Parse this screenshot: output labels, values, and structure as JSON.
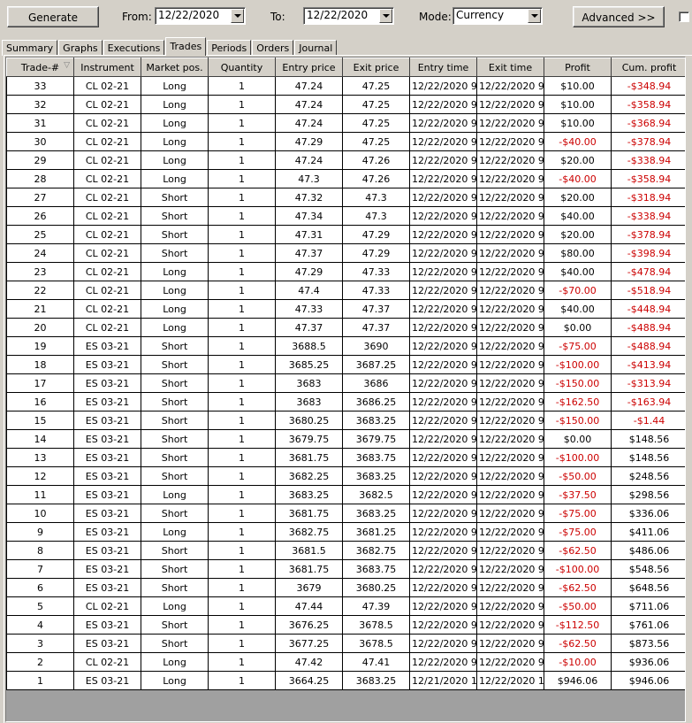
{
  "toolbar": {
    "generate_label": "Generate",
    "from_label": "From:",
    "from_value": "12/22/2020",
    "to_label": "To:",
    "to_value": "12/22/2020",
    "mode_label": "Mode:",
    "mode_value": "Currency",
    "advanced_label": "Advanced >>"
  },
  "tabs": [
    "Summary",
    "Graphs",
    "Executions",
    "Trades",
    "Periods",
    "Orders",
    "Journal"
  ],
  "active_tab": "Trades",
  "columns": [
    "Trade-#",
    "Instrument",
    "Market pos.",
    "Quantity",
    "Entry price",
    "Exit price",
    "Entry time",
    "Exit time",
    "Profit",
    "Cum. profit"
  ],
  "sort_indicator": "▽",
  "rows": [
    [
      "33",
      "CL 02-21",
      "Long",
      "1",
      "47.24",
      "47.25",
      "12/22/2020 9:",
      "12/22/2020 9:",
      "$10.00",
      "-$348.94"
    ],
    [
      "32",
      "CL 02-21",
      "Long",
      "1",
      "47.24",
      "47.25",
      "12/22/2020 9:",
      "12/22/2020 9:",
      "$10.00",
      "-$358.94"
    ],
    [
      "31",
      "CL 02-21",
      "Long",
      "1",
      "47.24",
      "47.25",
      "12/22/2020 9:",
      "12/22/2020 9:",
      "$10.00",
      "-$368.94"
    ],
    [
      "30",
      "CL 02-21",
      "Long",
      "1",
      "47.29",
      "47.25",
      "12/22/2020 9:",
      "12/22/2020 9:",
      "-$40.00",
      "-$378.94"
    ],
    [
      "29",
      "CL 02-21",
      "Long",
      "1",
      "47.24",
      "47.26",
      "12/22/2020 9:",
      "12/22/2020 9:",
      "$20.00",
      "-$338.94"
    ],
    [
      "28",
      "CL 02-21",
      "Long",
      "1",
      "47.3",
      "47.26",
      "12/22/2020 9:",
      "12/22/2020 9:",
      "-$40.00",
      "-$358.94"
    ],
    [
      "27",
      "CL 02-21",
      "Short",
      "1",
      "47.32",
      "47.3",
      "12/22/2020 9:",
      "12/22/2020 9:",
      "$20.00",
      "-$318.94"
    ],
    [
      "26",
      "CL 02-21",
      "Short",
      "1",
      "47.34",
      "47.3",
      "12/22/2020 9:",
      "12/22/2020 9:",
      "$40.00",
      "-$338.94"
    ],
    [
      "25",
      "CL 02-21",
      "Short",
      "1",
      "47.31",
      "47.29",
      "12/22/2020 9:",
      "12/22/2020 9:",
      "$20.00",
      "-$378.94"
    ],
    [
      "24",
      "CL 02-21",
      "Short",
      "1",
      "47.37",
      "47.29",
      "12/22/2020 9:",
      "12/22/2020 9:",
      "$80.00",
      "-$398.94"
    ],
    [
      "23",
      "CL 02-21",
      "Long",
      "1",
      "47.29",
      "47.33",
      "12/22/2020 9:",
      "12/22/2020 9:",
      "$40.00",
      "-$478.94"
    ],
    [
      "22",
      "CL 02-21",
      "Long",
      "1",
      "47.4",
      "47.33",
      "12/22/2020 9:",
      "12/22/2020 9:",
      "-$70.00",
      "-$518.94"
    ],
    [
      "21",
      "CL 02-21",
      "Long",
      "1",
      "47.33",
      "47.37",
      "12/22/2020 9:",
      "12/22/2020 9:",
      "$40.00",
      "-$448.94"
    ],
    [
      "20",
      "CL 02-21",
      "Long",
      "1",
      "47.37",
      "47.37",
      "12/22/2020 9:",
      "12/22/2020 9:",
      "$0.00",
      "-$488.94"
    ],
    [
      "19",
      "ES 03-21",
      "Short",
      "1",
      "3688.5",
      "3690",
      "12/22/2020 9:",
      "12/22/2020 9:",
      "-$75.00",
      "-$488.94"
    ],
    [
      "18",
      "ES 03-21",
      "Short",
      "1",
      "3685.25",
      "3687.25",
      "12/22/2020 9:",
      "12/22/2020 9:",
      "-$100.00",
      "-$413.94"
    ],
    [
      "17",
      "ES 03-21",
      "Short",
      "1",
      "3683",
      "3686",
      "12/22/2020 9:",
      "12/22/2020 9:",
      "-$150.00",
      "-$313.94"
    ],
    [
      "16",
      "ES 03-21",
      "Short",
      "1",
      "3683",
      "3686.25",
      "12/22/2020 9:",
      "12/22/2020 9:",
      "-$162.50",
      "-$163.94"
    ],
    [
      "15",
      "ES 03-21",
      "Short",
      "1",
      "3680.25",
      "3683.25",
      "12/22/2020 9:",
      "12/22/2020 9:",
      "-$150.00",
      "-$1.44"
    ],
    [
      "14",
      "ES 03-21",
      "Short",
      "1",
      "3679.75",
      "3679.75",
      "12/22/2020 9:",
      "12/22/2020 9:",
      "$0.00",
      "$148.56"
    ],
    [
      "13",
      "ES 03-21",
      "Short",
      "1",
      "3681.75",
      "3683.75",
      "12/22/2020 9:",
      "12/22/2020 9:",
      "-$100.00",
      "$148.56"
    ],
    [
      "12",
      "ES 03-21",
      "Short",
      "1",
      "3682.25",
      "3683.25",
      "12/22/2020 9:",
      "12/22/2020 9:",
      "-$50.00",
      "$248.56"
    ],
    [
      "11",
      "ES 03-21",
      "Long",
      "1",
      "3683.25",
      "3682.5",
      "12/22/2020 9:",
      "12/22/2020 9:",
      "-$37.50",
      "$298.56"
    ],
    [
      "10",
      "ES 03-21",
      "Short",
      "1",
      "3681.75",
      "3683.25",
      "12/22/2020 9:",
      "12/22/2020 9:",
      "-$75.00",
      "$336.06"
    ],
    [
      "9",
      "ES 03-21",
      "Long",
      "1",
      "3682.75",
      "3681.25",
      "12/22/2020 9:",
      "12/22/2020 9:",
      "-$75.00",
      "$411.06"
    ],
    [
      "8",
      "ES 03-21",
      "Short",
      "1",
      "3681.5",
      "3682.75",
      "12/22/2020 9:",
      "12/22/2020 9:",
      "-$62.50",
      "$486.06"
    ],
    [
      "7",
      "ES 03-21",
      "Short",
      "1",
      "3681.75",
      "3683.75",
      "12/22/2020 9:",
      "12/22/2020 9:",
      "-$100.00",
      "$548.56"
    ],
    [
      "6",
      "ES 03-21",
      "Short",
      "1",
      "3679",
      "3680.25",
      "12/22/2020 9:",
      "12/22/2020 9:",
      "-$62.50",
      "$648.56"
    ],
    [
      "5",
      "CL 02-21",
      "Long",
      "1",
      "47.44",
      "47.39",
      "12/22/2020 9:",
      "12/22/2020 9:",
      "-$50.00",
      "$711.06"
    ],
    [
      "4",
      "ES 03-21",
      "Short",
      "1",
      "3676.25",
      "3678.5",
      "12/22/2020 9:",
      "12/22/2020 9:",
      "-$112.50",
      "$761.06"
    ],
    [
      "3",
      "ES 03-21",
      "Short",
      "1",
      "3677.25",
      "3678.5",
      "12/22/2020 9:",
      "12/22/2020 9:",
      "-$62.50",
      "$873.56"
    ],
    [
      "2",
      "CL 02-21",
      "Long",
      "1",
      "47.42",
      "47.41",
      "12/22/2020 9:",
      "12/22/2020 9:",
      "-$10.00",
      "$936.06"
    ],
    [
      "1",
      "ES 03-21",
      "Long",
      "1",
      "3664.25",
      "3683.25",
      "12/21/2020 1",
      "12/22/2020 1",
      "$946.06",
      "$946.06"
    ]
  ],
  "colors": {
    "negative": "#cc0000",
    "window_bg": "#d4d0c8",
    "empty_grid_bg": "#a0a0a0"
  }
}
